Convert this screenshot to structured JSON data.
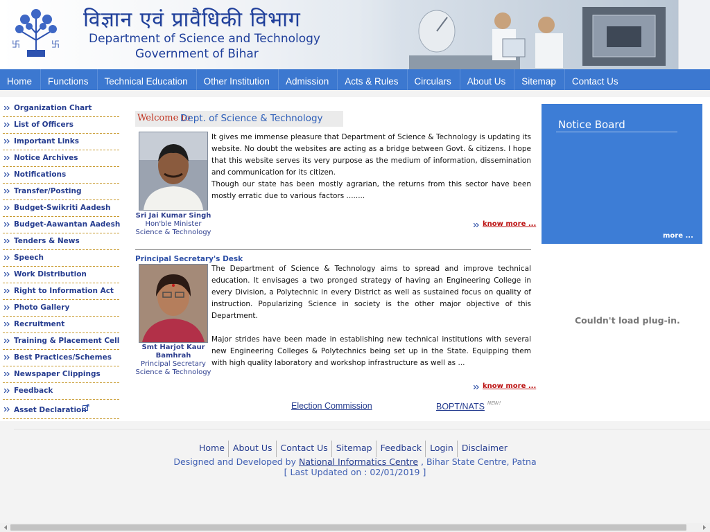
{
  "header": {
    "title_hindi": "विज्ञान एवं प्रावैधिकी विभाग",
    "title_en_line1": "Department of Science and Technology",
    "title_en_line2": "Government of Bihar"
  },
  "nav": {
    "items": [
      "Home",
      "Functions",
      "Technical Education",
      "Other Institution",
      "Admission",
      "Acts & Rules",
      "Circulars",
      "About Us",
      "Sitemap",
      "Contact Us"
    ]
  },
  "sidebar": {
    "items": [
      {
        "label": "Organization Chart"
      },
      {
        "label": "List of Officers"
      },
      {
        "label": "Important Links"
      },
      {
        "label": "Notice Archives"
      },
      {
        "label": "Notifications"
      },
      {
        "label": "Transfer/Posting"
      },
      {
        "label": "Budget-Swikriti Aadesh"
      },
      {
        "label": "Budget-Aawantan Aadesh"
      },
      {
        "label": "Tenders & News"
      },
      {
        "label": "Speech"
      },
      {
        "label": "Work Distribution"
      },
      {
        "label": "Right to Information Act"
      },
      {
        "label": "Photo Gallery"
      },
      {
        "label": "Recruitment"
      },
      {
        "label": "Training & Placement Cell"
      },
      {
        "label": "Best Practices/Schemes"
      },
      {
        "label": "Newspaper Clippings"
      },
      {
        "label": "Feedback"
      },
      {
        "label": "Asset Declaration"
      }
    ]
  },
  "welcome": {
    "prefix": "Welcome to",
    "dept": "Dept. of Science & Technology"
  },
  "minister": {
    "name": "Sri Jai Kumar Singh",
    "title": "Hon'ble Minister",
    "dept": "Science & Technology",
    "para1": "It gives me immense pleasure that Department of Science & Technology is updating its website. No doubt the websites are acting as a bridge between Govt. & citizens. I hope that this website serves its very purpose as the medium of information, dissemination and communication for its citizen.",
    "para2": "Though our state has been mostly agrarian, the returns from this sector have been mostly erratic due to various factors ........",
    "know_more": "know more ..."
  },
  "secretary": {
    "heading": "Principal Secretary's Desk",
    "name": "Smt Harjot Kaur Bamhrah",
    "title": "Principal Secretary",
    "dept": "Science & Technology",
    "para1": "The Department of Science & Technology aims to spread and improve technical education. It envisages a two pronged strategy of having an Engineering College in every Division, a Polytechnic in every District as well as sustained focus on quality of instruction. Popularizing Science in society is the other major objective of this Department.",
    "para2": "Major strides have been made in establishing new technical institutions with several new Engineering Colleges & Polytechnics being set up in the State. Equipping them with high quality laboratory and workshop infrastructure as well as ...",
    "know_more": "know more ..."
  },
  "links": {
    "election": "Election Commission",
    "bopt": "BOPT/NATS",
    "new_badge": "NEW!"
  },
  "notice_board": {
    "title": "Notice Board",
    "more": "more ..."
  },
  "plugin_message": "Couldn't load plug-in.",
  "footer": {
    "links": [
      "Home",
      "About Us",
      "Contact Us",
      "Sitemap",
      "Feedback",
      "Login",
      "Disclaimer"
    ],
    "designed_prefix": "Designed and Developed by",
    "designed_link": "National Informatics Centre",
    "designed_suffix": ", Bihar State Centre, Patna",
    "last_updated": "[ Last Updated on : 02/01/2019 ]"
  },
  "colors": {
    "nav_bg": "#3c78d0",
    "notice_bg": "#3d7dd6",
    "link_blue": "#253c8f",
    "know_more_red": "#bb1010",
    "sidebar_rule": "#c89a2e"
  }
}
